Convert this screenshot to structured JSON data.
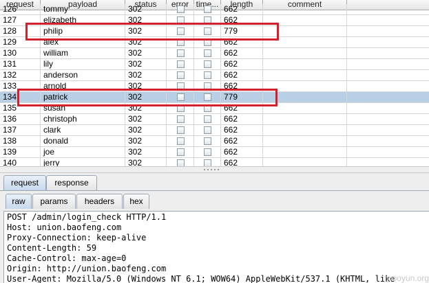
{
  "results_table": {
    "columns": [
      {
        "key": "request",
        "label": "request"
      },
      {
        "key": "payload",
        "label": "payload"
      },
      {
        "key": "status",
        "label": "status"
      },
      {
        "key": "error",
        "label": "error"
      },
      {
        "key": "timeout",
        "label": "time..."
      },
      {
        "key": "length",
        "label": "length"
      },
      {
        "key": "comment",
        "label": "comment"
      }
    ],
    "rows": [
      {
        "request": "126",
        "payload": "tommy",
        "status": "302",
        "error": false,
        "timeout": false,
        "length": "662",
        "comment": "",
        "selected": false
      },
      {
        "request": "127",
        "payload": "elizabeth",
        "status": "302",
        "error": false,
        "timeout": false,
        "length": "662",
        "comment": "",
        "selected": false
      },
      {
        "request": "128",
        "payload": "philip",
        "status": "302",
        "error": false,
        "timeout": false,
        "length": "779",
        "comment": "",
        "selected": false
      },
      {
        "request": "129",
        "payload": "alex",
        "status": "302",
        "error": false,
        "timeout": false,
        "length": "662",
        "comment": "",
        "selected": false
      },
      {
        "request": "130",
        "payload": "william",
        "status": "302",
        "error": false,
        "timeout": false,
        "length": "662",
        "comment": "",
        "selected": false
      },
      {
        "request": "131",
        "payload": "lily",
        "status": "302",
        "error": false,
        "timeout": false,
        "length": "662",
        "comment": "",
        "selected": false
      },
      {
        "request": "132",
        "payload": "anderson",
        "status": "302",
        "error": false,
        "timeout": false,
        "length": "662",
        "comment": "",
        "selected": false
      },
      {
        "request": "133",
        "payload": "arnold",
        "status": "302",
        "error": false,
        "timeout": false,
        "length": "662",
        "comment": "",
        "selected": false
      },
      {
        "request": "134",
        "payload": "patrick",
        "status": "302",
        "error": false,
        "timeout": false,
        "length": "779",
        "comment": "",
        "selected": true
      },
      {
        "request": "135",
        "payload": "susan",
        "status": "302",
        "error": false,
        "timeout": false,
        "length": "662",
        "comment": "",
        "selected": false
      },
      {
        "request": "136",
        "payload": "christoph",
        "status": "302",
        "error": false,
        "timeout": false,
        "length": "662",
        "comment": "",
        "selected": false
      },
      {
        "request": "137",
        "payload": "clark",
        "status": "302",
        "error": false,
        "timeout": false,
        "length": "662",
        "comment": "",
        "selected": false
      },
      {
        "request": "138",
        "payload": "donald",
        "status": "302",
        "error": false,
        "timeout": false,
        "length": "662",
        "comment": "",
        "selected": false
      },
      {
        "request": "139",
        "payload": "joe",
        "status": "302",
        "error": false,
        "timeout": false,
        "length": "662",
        "comment": "",
        "selected": false
      },
      {
        "request": "140",
        "payload": "jerry",
        "status": "302",
        "error": false,
        "timeout": false,
        "length": "662",
        "comment": "",
        "selected": false
      }
    ],
    "highlighted_rows": [
      "128",
      "134"
    ],
    "highlight_color": "#d3202c",
    "selected_row_color": "#b8cfe5"
  },
  "detail_tabs": [
    {
      "label": "request",
      "active": true
    },
    {
      "label": "response",
      "active": false
    }
  ],
  "view_tabs": [
    {
      "label": "raw",
      "active": true
    },
    {
      "label": "params",
      "active": false
    },
    {
      "label": "headers",
      "active": false
    },
    {
      "label": "hex",
      "active": false
    }
  ],
  "raw_request": [
    "POST /admin/login_check HTTP/1.1",
    "Host: union.baofeng.com",
    "Proxy-Connection: keep-alive",
    "Content-Length: 59",
    "Cache-Control: max-age=0",
    "Origin: http://union.baofeng.com",
    "User-Agent: Mozilla/5.0 (Windows NT 6.1; WOW64) AppleWebKit/537.1 (KHTML, like"
  ],
  "watermark": "wooyun.org"
}
